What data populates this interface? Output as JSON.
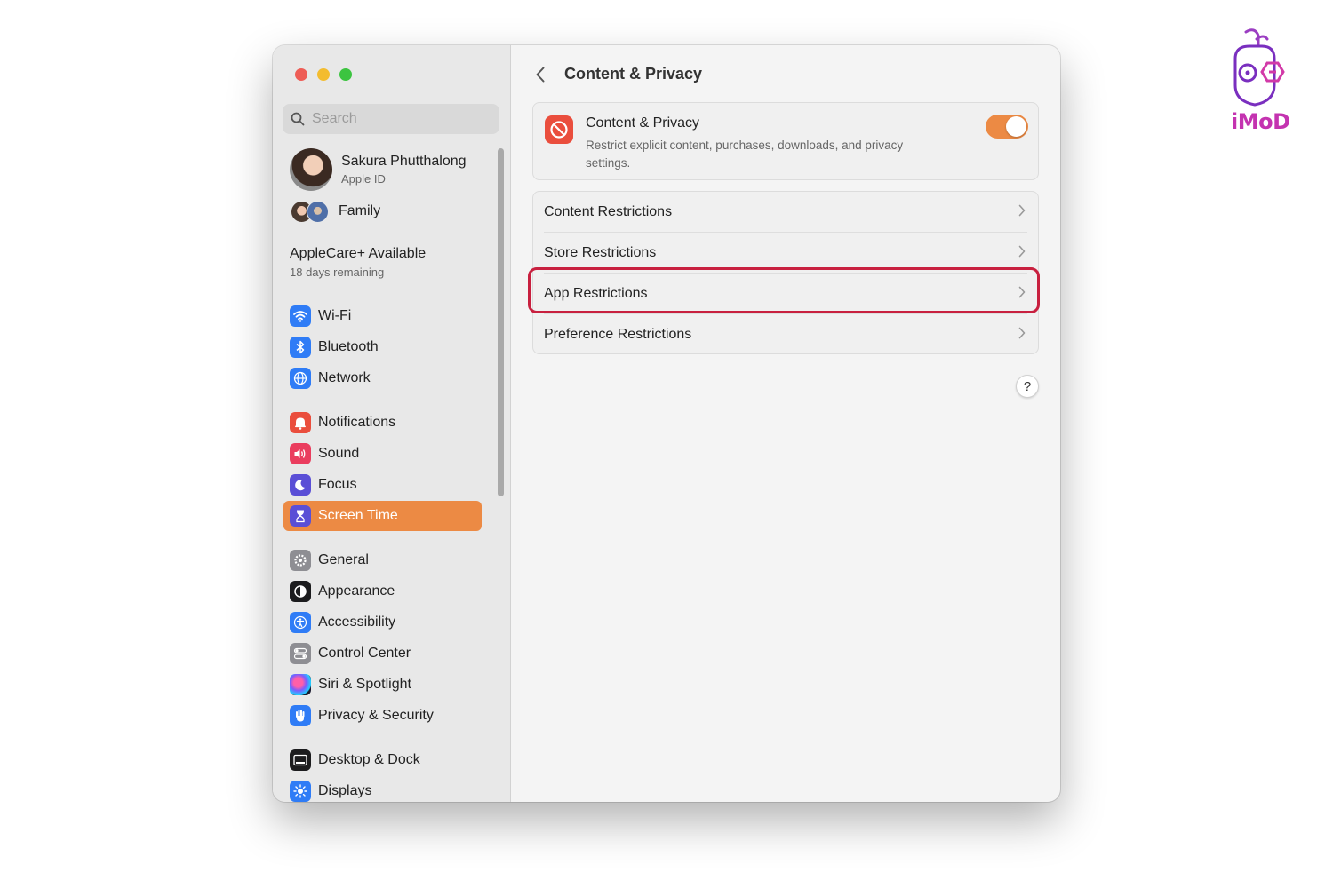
{
  "sidebar": {
    "search_placeholder": "Search",
    "profile": {
      "name": "Sakura Phutthalong",
      "subtitle": "Apple ID"
    },
    "family_label": "Family",
    "applecare": {
      "title": "AppleCare+ Available",
      "subtitle": "18 days remaining"
    },
    "items": [
      {
        "label": "Wi-Fi",
        "icon": "wifi-icon",
        "color": "#2f7cf6"
      },
      {
        "label": "Bluetooth",
        "icon": "bluetooth-icon",
        "color": "#2f7cf6"
      },
      {
        "label": "Network",
        "icon": "globe-icon",
        "color": "#2f7cf6"
      },
      {
        "label": "Notifications",
        "icon": "bell-icon",
        "color": "#ea4e3d"
      },
      {
        "label": "Sound",
        "icon": "speaker-icon",
        "color": "#ea3d5e"
      },
      {
        "label": "Focus",
        "icon": "moon-icon",
        "color": "#5a4fd6"
      },
      {
        "label": "Screen Time",
        "icon": "hourglass-icon",
        "color": "#5a4fd6"
      },
      {
        "label": "General",
        "icon": "gear-icon",
        "color": "#8e8e93"
      },
      {
        "label": "Appearance",
        "icon": "appearance-icon",
        "color": "#1c1c1e"
      },
      {
        "label": "Accessibility",
        "icon": "accessibility-icon",
        "color": "#2f7cf6"
      },
      {
        "label": "Control Center",
        "icon": "control-center-icon",
        "color": "#8e8e93"
      },
      {
        "label": "Siri & Spotlight",
        "icon": "siri-icon",
        "color": "#3a2d6b"
      },
      {
        "label": "Privacy & Security",
        "icon": "hand-icon",
        "color": "#2f7cf6"
      },
      {
        "label": "Desktop & Dock",
        "icon": "dock-icon",
        "color": "#1c1c1e"
      },
      {
        "label": "Displays",
        "icon": "sun-icon",
        "color": "#2f7cf6"
      }
    ],
    "active_item": "Screen Time"
  },
  "main": {
    "title": "Content & Privacy",
    "content_privacy": {
      "title": "Content & Privacy",
      "description": "Restrict explicit content, purchases, downloads, and privacy settings.",
      "enabled": true
    },
    "restrictions": [
      {
        "label": "Content Restrictions"
      },
      {
        "label": "Store Restrictions"
      },
      {
        "label": "App Restrictions",
        "highlighted": true
      },
      {
        "label": "Preference Restrictions"
      }
    ],
    "help_label": "?"
  },
  "watermark": {
    "brand": "iMoD"
  },
  "colors": {
    "accent": "#ec8a44",
    "highlight": "#c8203f",
    "brand": "#c433b0"
  }
}
